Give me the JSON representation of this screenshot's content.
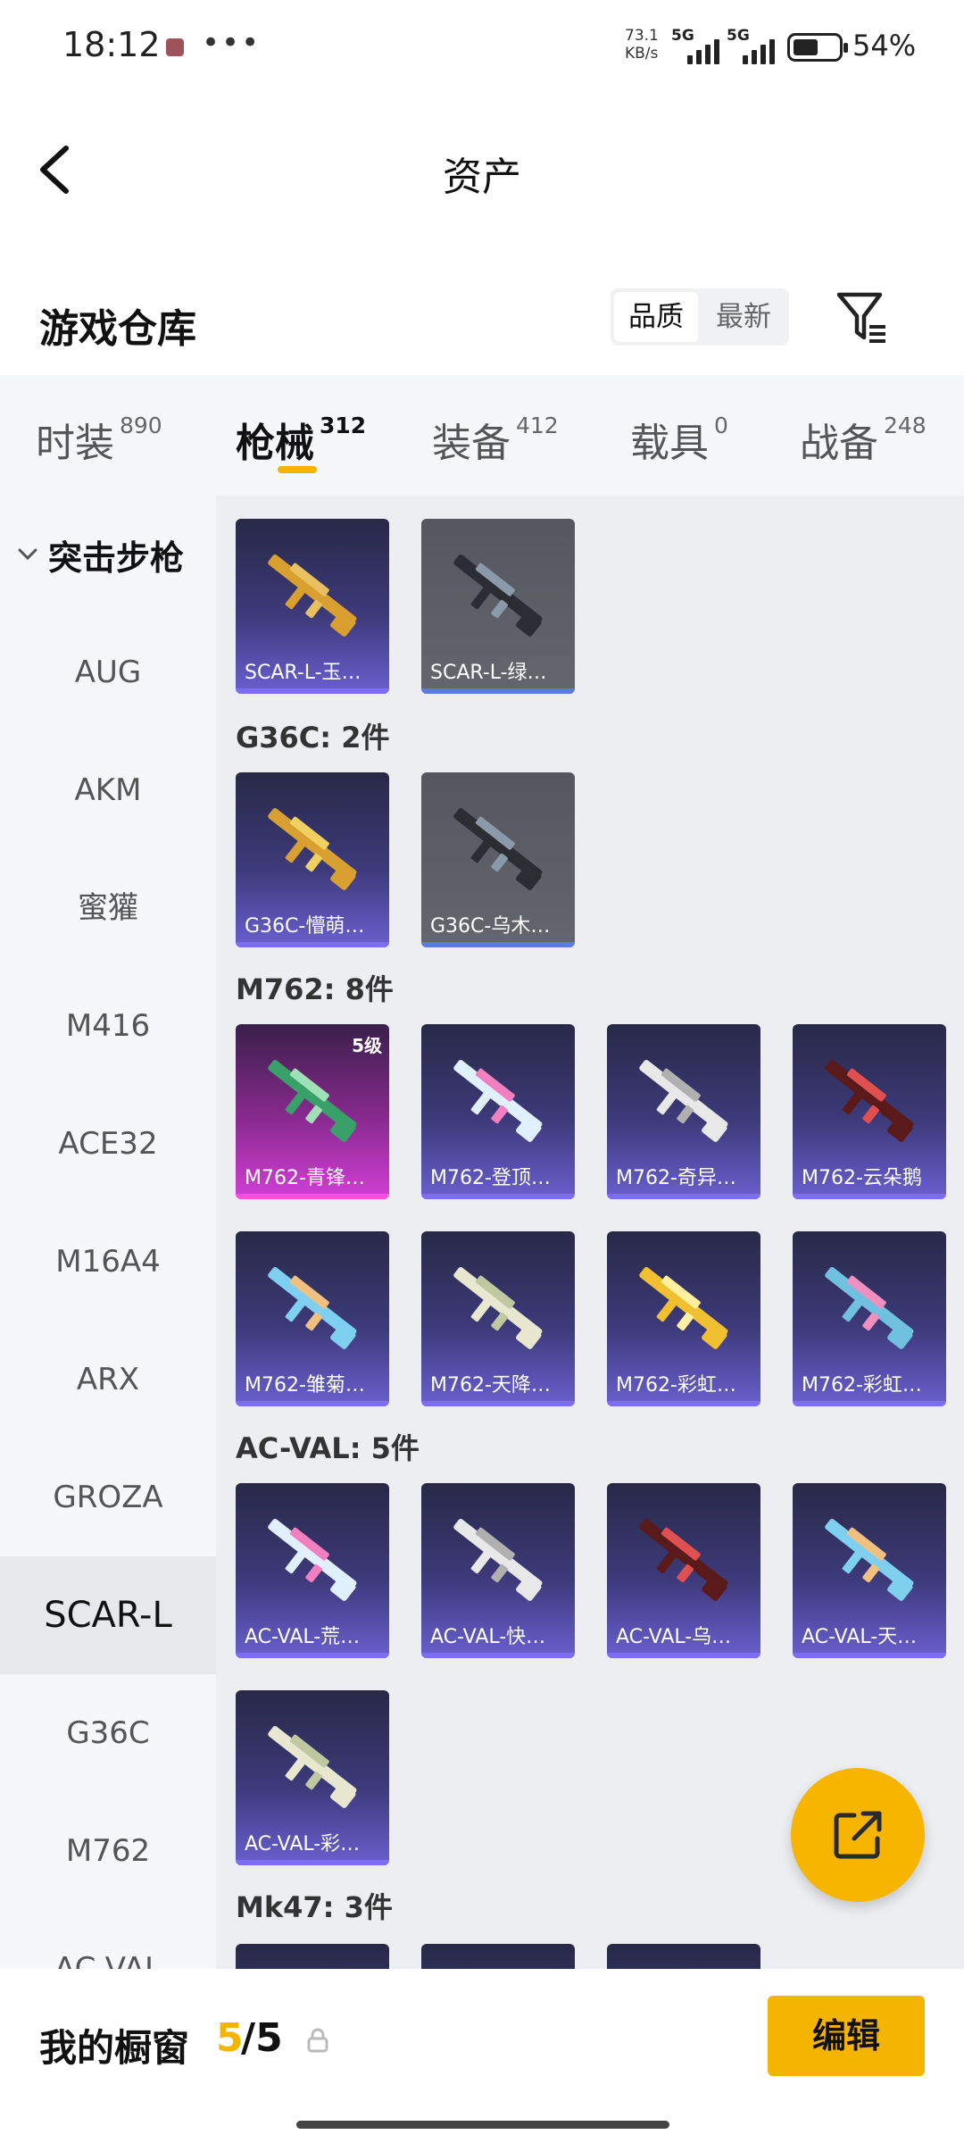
{
  "status_bar": {
    "time": "18:12",
    "speed_value": "73.1",
    "speed_unit": "KB/s",
    "sim1_label": "5G",
    "sim2_label": "5G",
    "battery_percent": "54%",
    "battery_level": 0.54
  },
  "header": {
    "title": "资产"
  },
  "toolbar": {
    "warehouse_title": "游戏仓库",
    "sort_quality": "品质",
    "sort_latest": "最新"
  },
  "tabs": [
    {
      "label": "时装",
      "count": "890"
    },
    {
      "label": "枪械",
      "count": "312"
    },
    {
      "label": "装备",
      "count": "412"
    },
    {
      "label": "载具",
      "count": "0"
    },
    {
      "label": "战备",
      "count": "248"
    }
  ],
  "sidebar": {
    "group_label": "突击步枪",
    "items": [
      "AUG",
      "AKM",
      "蜜獾",
      "M416",
      "ACE32",
      "M16A4",
      "ARX",
      "GROZA",
      "SCAR-L",
      "G36C",
      "M762",
      "AC-VAL"
    ]
  },
  "sections": {
    "top_items": [
      {
        "name": "SCAR-L-玉…",
        "style": "purple"
      },
      {
        "name": "SCAR-L-绿…",
        "style": "grey"
      }
    ],
    "g36c": {
      "label": "G36C: 2件",
      "items": [
        {
          "name": "G36C-懵萌…",
          "style": "purple"
        },
        {
          "name": "G36C-乌木…",
          "style": "grey"
        }
      ]
    },
    "m762": {
      "label": "M762: 8件",
      "items": [
        {
          "name": "M762-青锋…",
          "style": "pink",
          "level": "5级"
        },
        {
          "name": "M762-登顶…",
          "style": "purple"
        },
        {
          "name": "M762-奇异…",
          "style": "purple"
        },
        {
          "name": "M762-云朵鹅",
          "style": "purple"
        },
        {
          "name": "M762-雏菊…",
          "style": "purple"
        },
        {
          "name": "M762-天降…",
          "style": "purple"
        },
        {
          "name": "M762-彩虹…",
          "style": "purple"
        },
        {
          "name": "M762-彩虹…",
          "style": "purple"
        }
      ]
    },
    "acval": {
      "label": "AC-VAL: 5件",
      "items": [
        {
          "name": "AC-VAL-荒…",
          "style": "purple"
        },
        {
          "name": "AC-VAL-快…",
          "style": "purple"
        },
        {
          "name": "AC-VAL-乌…",
          "style": "purple"
        },
        {
          "name": "AC-VAL-天…",
          "style": "purple"
        },
        {
          "name": "AC-VAL-彩…",
          "style": "purple"
        }
      ]
    },
    "mk47": {
      "label": "Mk47: 3件"
    }
  },
  "bottom": {
    "label": "我的橱窗",
    "count": "5",
    "total": "/5",
    "edit_label": "编辑"
  },
  "colors": {
    "accent": "#f5b400",
    "card_purple": "#3d3a7a",
    "card_grey": "#5f6168",
    "card_pink": "#b334b8"
  }
}
